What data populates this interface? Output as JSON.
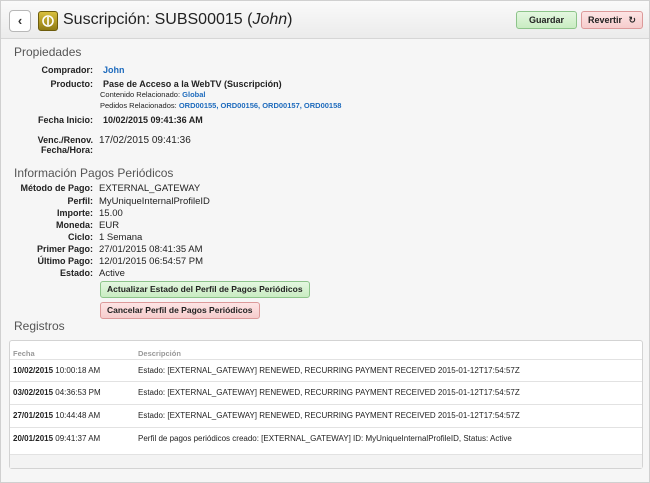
{
  "header": {
    "title_prefix": "Suscripción: SUBS00015",
    "title_user": "John",
    "save_label": "Guardar",
    "revert_label": "Revertir"
  },
  "propiedades": {
    "section_title": "Propiedades",
    "comprador_label": "Comprador:",
    "comprador_value": "John",
    "producto_label": "Producto:",
    "producto_value": "Pase de Acceso a la WebTV (Suscripción)",
    "contenido_label": "Contenido Relacionado:",
    "contenido_value": "Global",
    "pedidos_label": "Pedidos Relacionados:",
    "pedidos": [
      "ORD00155,",
      "ORD00156,",
      "ORD00157,",
      "ORD00158"
    ],
    "fecha_inicio_label": "Fecha Inicio:",
    "fecha_inicio_value": "10/02/2015 09:41:36 AM",
    "venc_label_1": "Venc./Renov.",
    "venc_label_2": "Fecha/Hora:",
    "venc_value": "17/02/2015 09:41:36"
  },
  "pagos": {
    "section_title": "Información Pagos Periódicos",
    "rows": [
      {
        "label": "Método de Pago:",
        "value": "EXTERNAL_GATEWAY"
      },
      {
        "label": "Perfil:",
        "value": "MyUniqueInternalProfileID"
      },
      {
        "label": "Importe:",
        "value": "15.00"
      },
      {
        "label": "Moneda:",
        "value": "EUR"
      },
      {
        "label": "Ciclo:",
        "value": "1 Semana"
      },
      {
        "label": "Primer Pago:",
        "value": "27/01/2015 08:41:35 AM"
      },
      {
        "label": "Último Pago:",
        "value": "12/01/2015 06:54:57 PM"
      },
      {
        "label": "Estado:",
        "value": "Active"
      }
    ],
    "update_btn": "Actualizar Estado del Perfil de Pagos Periódicos",
    "cancel_btn": "Cancelar Perfil de Pagos Periódicos"
  },
  "registros": {
    "section_title": "Registros",
    "col_fecha": "Fecha",
    "col_desc": "Descripción",
    "rows": [
      {
        "date": "10/02/2015",
        "time": "10:00:18 AM",
        "desc": "Estado: [EXTERNAL_GATEWAY] RENEWED, RECURRING PAYMENT RECEIVED 2015-01-12T17:54:57Z"
      },
      {
        "date": "03/02/2015",
        "time": "04:36:53 PM",
        "desc": "Estado: [EXTERNAL_GATEWAY] RENEWED, RECURRING PAYMENT RECEIVED 2015-01-12T17:54:57Z"
      },
      {
        "date": "27/01/2015",
        "time": "10:44:48 AM",
        "desc": "Estado: [EXTERNAL_GATEWAY] RENEWED, RECURRING PAYMENT RECEIVED 2015-01-12T17:54:57Z"
      },
      {
        "date": "20/01/2015",
        "time": "09:41:37 AM",
        "desc": "Perfil de pagos periódicos creado: [EXTERNAL_GATEWAY] ID: MyUniqueInternalProfileID, Status: Active"
      }
    ]
  }
}
